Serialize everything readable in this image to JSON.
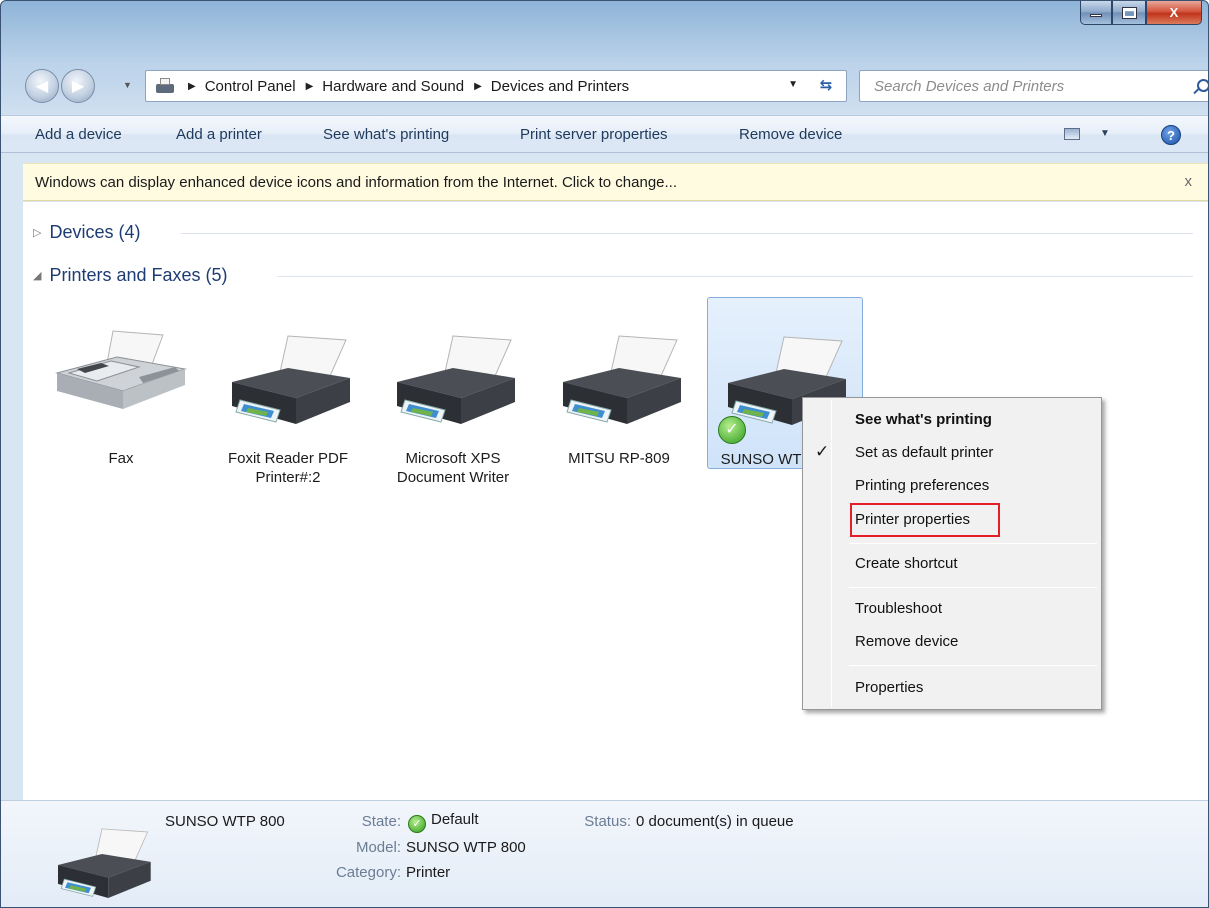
{
  "window": {
    "min_glyph": "—",
    "max_glyph": "□",
    "close_glyph": "X"
  },
  "nav": {
    "back_glyph": "◀",
    "forward_glyph": "▶",
    "breadcrumb": [
      "Control Panel",
      "Hardware and Sound",
      "Devices and Printers"
    ],
    "search_placeholder": "Search Devices and Printers"
  },
  "toolbar": {
    "add_device": "Add a device",
    "add_printer": "Add a printer",
    "see_printing": "See what's printing",
    "print_server": "Print server properties",
    "remove_device": "Remove device",
    "help": "?"
  },
  "infobar": {
    "message": "Windows can display enhanced device icons and information from the Internet. Click to change...",
    "close": "x"
  },
  "groups": {
    "devices": "Devices (4)",
    "printers": "Printers and Faxes (5)"
  },
  "items": [
    {
      "line1": "Fax",
      "line2": ""
    },
    {
      "line1": "Foxit Reader PDF",
      "line2": "Printer#:2"
    },
    {
      "line1": "Microsoft XPS",
      "line2": "Document Writer"
    },
    {
      "line1": "MITSU RP-809",
      "line2": ""
    },
    {
      "line1": "SUNSO WT",
      "line2": ""
    }
  ],
  "context_menu": {
    "see_printing": "See what's printing",
    "set_default": "Set as default printer",
    "preferences": "Printing preferences",
    "printer_properties": "Printer properties",
    "create_shortcut": "Create shortcut",
    "troubleshoot": "Troubleshoot",
    "remove_device": "Remove device",
    "properties": "Properties",
    "check_glyph": "✓"
  },
  "details": {
    "name": "SUNSO WTP 800",
    "state_label": "State:",
    "state_value": "Default",
    "model_label": "Model:",
    "model_value": "SUNSO WTP 800",
    "category_label": "Category:",
    "category_value": "Printer",
    "status_label": "Status:",
    "status_value": "0 document(s) in queue"
  },
  "colors": {
    "accent_highlight": "#e3202a",
    "group_heading": "#1e3c74",
    "selection": "#cfe3f9"
  }
}
